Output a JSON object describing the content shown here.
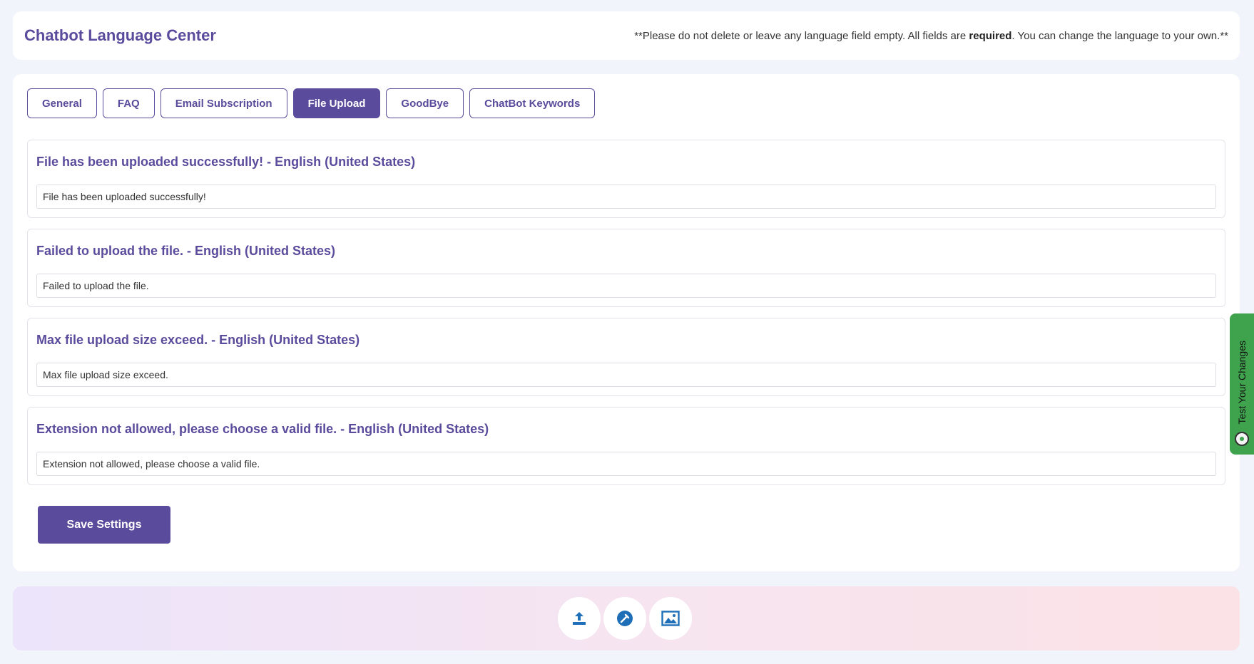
{
  "header": {
    "title": "Chatbot Language Center",
    "notice_prefix": "**Please do not delete or leave any language field empty. All fields are ",
    "notice_bold": "required",
    "notice_suffix": ". You can change the language to your own.**"
  },
  "tabs": [
    {
      "label": "General",
      "active": false
    },
    {
      "label": "FAQ",
      "active": false
    },
    {
      "label": "Email Subscription",
      "active": false
    },
    {
      "label": "File Upload",
      "active": true
    },
    {
      "label": "GoodBye",
      "active": false
    },
    {
      "label": "ChatBot Keywords",
      "active": false
    }
  ],
  "sections": [
    {
      "title": "File has been uploaded successfully! - English (United States)",
      "value": "File has been uploaded successfully!"
    },
    {
      "title": "Failed to upload the file. - English (United States)",
      "value": "Failed to upload the file."
    },
    {
      "title": "Max file upload size exceed. - English (United States)",
      "value": "Max file upload size exceed."
    },
    {
      "title": "Extension not allowed, please choose a valid file. - English (United States)",
      "value": "Extension not allowed, please choose a valid file."
    }
  ],
  "actions": {
    "save_label": "Save Settings"
  },
  "side_tab": {
    "label": "Test Your Changes",
    "icon": "chatbot-icon"
  },
  "footer": {
    "icons": [
      "upload-icon",
      "wrench-icon",
      "image-icon"
    ]
  },
  "colors": {
    "brand": "#5b4b9c",
    "side_tab": "#3fa34d",
    "footer_icon": "#1e6fb8"
  }
}
